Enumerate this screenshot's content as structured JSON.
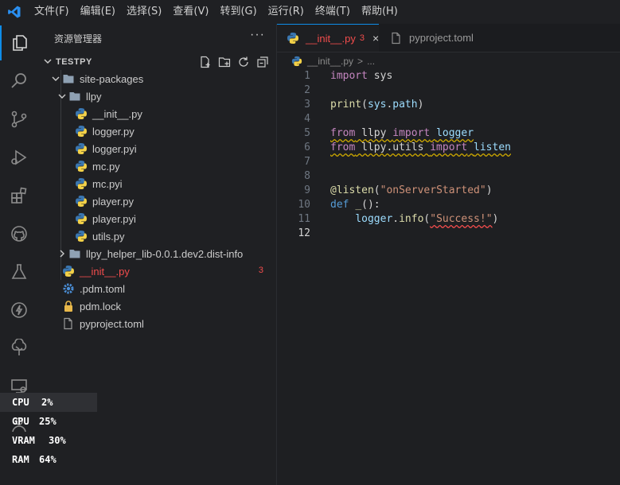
{
  "menubar": {
    "logo_icon": "vscode-logo",
    "items": [
      "文件(F)",
      "编辑(E)",
      "选择(S)",
      "查看(V)",
      "转到(G)",
      "运行(R)",
      "终端(T)",
      "帮助(H)"
    ]
  },
  "activitybar": {
    "items": [
      "explorer-icon",
      "search-icon",
      "source-control-icon",
      "run-debug-icon",
      "extensions-icon",
      "github-icon",
      "testing-icon",
      "lightning-icon",
      "tree-icon",
      "remote-explorer-icon",
      "accounts-icon"
    ]
  },
  "sidebar": {
    "title": "资源管理器",
    "more": "···",
    "section": "TESTPY",
    "tree": [
      {
        "label": "site-packages",
        "indent": 1,
        "kind": "folder",
        "expanded": true
      },
      {
        "label": "llpy",
        "indent": 2,
        "kind": "folder",
        "expanded": true
      },
      {
        "label": "__init__.py",
        "indent": 3,
        "kind": "python"
      },
      {
        "label": "logger.py",
        "indent": 3,
        "kind": "python"
      },
      {
        "label": "logger.pyi",
        "indent": 3,
        "kind": "python"
      },
      {
        "label": "mc.py",
        "indent": 3,
        "kind": "python"
      },
      {
        "label": "mc.pyi",
        "indent": 3,
        "kind": "python"
      },
      {
        "label": "player.py",
        "indent": 3,
        "kind": "python"
      },
      {
        "label": "player.pyi",
        "indent": 3,
        "kind": "python"
      },
      {
        "label": "utils.py",
        "indent": 3,
        "kind": "python"
      },
      {
        "label": "llpy_helper_lib-0.0.1.dev2.dist-info",
        "indent": 2,
        "kind": "folder",
        "expanded": false
      },
      {
        "label": "__init__.py",
        "indent": 1,
        "kind": "python",
        "error": true,
        "badge": "3"
      },
      {
        "label": ".pdm.toml",
        "indent": 1,
        "kind": "gear"
      },
      {
        "label": "pdm.lock",
        "indent": 1,
        "kind": "lock"
      },
      {
        "label": "pyproject.toml",
        "indent": 1,
        "kind": "toml"
      }
    ]
  },
  "editor": {
    "tabs": [
      {
        "label": "__init__.py",
        "badge": "3",
        "close": "×",
        "active": true
      },
      {
        "label": "pyproject.toml",
        "active": false
      }
    ],
    "breadcrumb": {
      "file": "__init__.py",
      "sep": ">",
      "more": "..."
    },
    "current_line": 12
  },
  "perf": {
    "rows": [
      {
        "label": "CPU",
        "value": "2%"
      },
      {
        "label": "GPU",
        "value": "25%"
      },
      {
        "label": "VRAM",
        "value": "30%"
      },
      {
        "label": "RAM",
        "value": "64%"
      }
    ]
  },
  "colors": {
    "accent": "#0e8ce8",
    "error": "#f14c4c",
    "warning": "#cca700"
  }
}
